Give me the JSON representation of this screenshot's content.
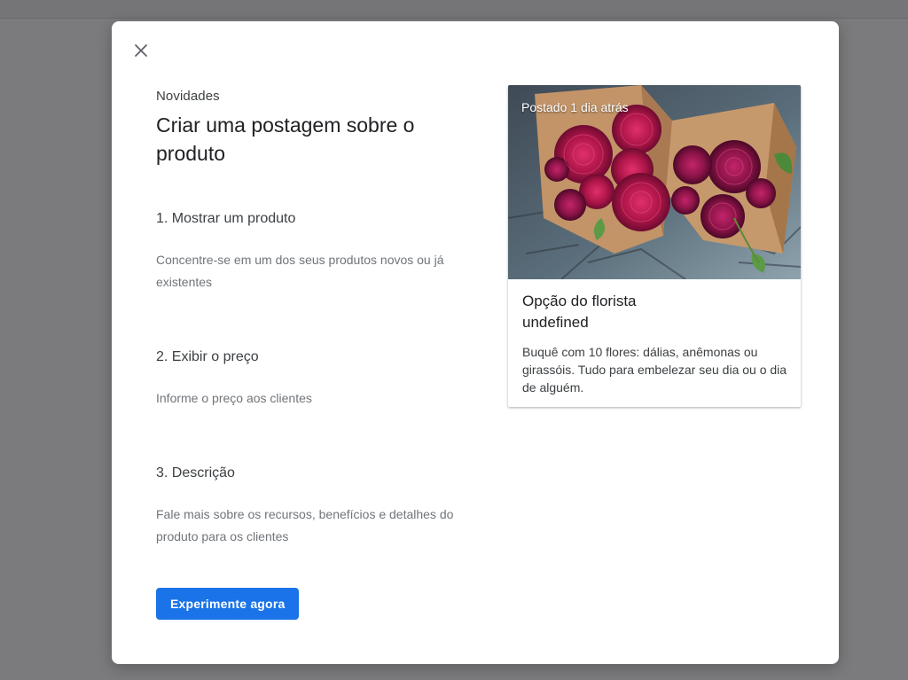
{
  "dialog": {
    "eyebrow": "Novidades",
    "title": "Criar uma postagem sobre o produto",
    "steps": [
      {
        "title": "1. Mostrar um produto",
        "description": "Concentre-se em um dos seus produtos novos ou já existentes"
      },
      {
        "title": "2. Exibir o preço",
        "description": "Informe o preço aos clientes"
      },
      {
        "title": "3. Descrição",
        "description": "Fale mais sobre os recursos, benefícios e detalhes do produto para os clientes"
      }
    ],
    "cta_label": "Experimente agora"
  },
  "preview_card": {
    "posted_label": "Postado 1 dia atrás",
    "title_line1": "Opção do florista",
    "title_line2": "undefined",
    "description": "Buquê com 10 flores: dálias, anêmonas ou girassóis. Tudo para embelezar seu dia ou o dia de alguém."
  },
  "icons": {
    "close": "close-icon"
  },
  "colors": {
    "accent": "#1a73e8",
    "overlay": "#7b7b7d",
    "flower": "#b0164a",
    "wrapping_paper": "#c29468"
  }
}
